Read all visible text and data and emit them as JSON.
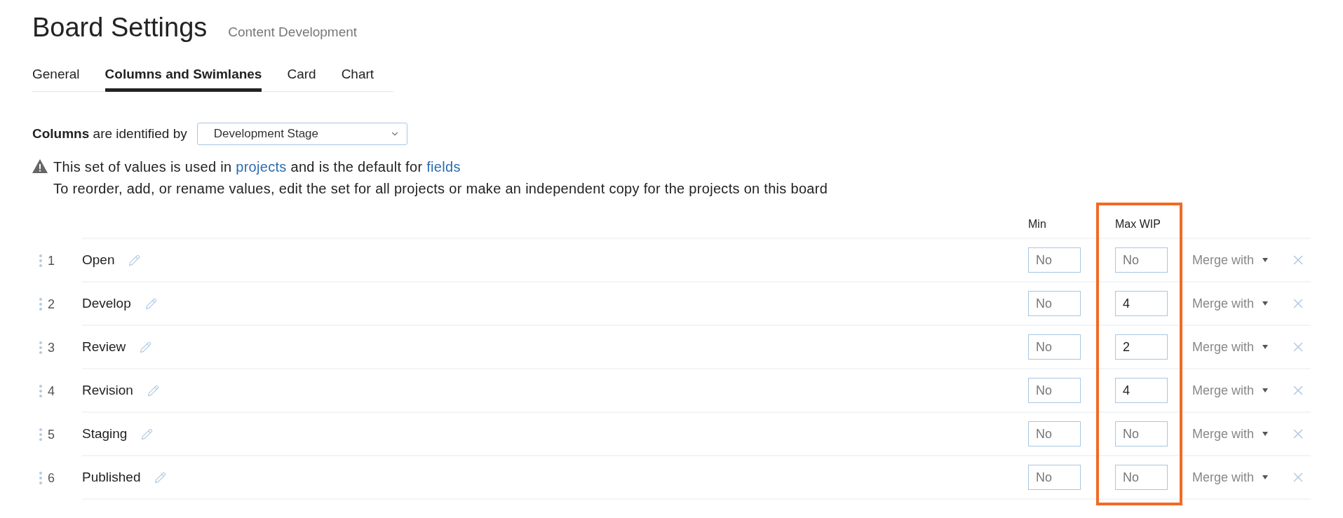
{
  "header": {
    "title": "Board Settings",
    "subtitle": "Content Development"
  },
  "tabs": [
    {
      "label": "General",
      "selected": false
    },
    {
      "label": "Columns and Swimlanes",
      "selected": true
    },
    {
      "label": "Card",
      "selected": false
    },
    {
      "label": "Chart",
      "selected": false
    }
  ],
  "identified_by": {
    "label_bold": "Columns",
    "label": "are identified by",
    "value": "Development Stage"
  },
  "notice": {
    "parts": [
      {
        "kind": "text",
        "text": "This set of values is used in "
      },
      {
        "kind": "link",
        "text": "projects"
      },
      {
        "kind": "text",
        "text": " and is the default for "
      },
      {
        "kind": "link",
        "text": "fields"
      }
    ],
    "line_2": "To reorder, add, or rename values, edit the set for all projects or make an independent copy for the projects on this board"
  },
  "table": {
    "columns": [
      {
        "label": "Min",
        "highlighted": false
      },
      {
        "label": "Max WIP",
        "highlighted": true
      }
    ],
    "rows": [
      {
        "number": "1",
        "name": "Open",
        "min": {
          "placeholder": "No"
        },
        "max_wip": {
          "placeholder": "No"
        },
        "merge": "Merge with"
      },
      {
        "number": "2",
        "name": "Develop",
        "min": {
          "placeholder": "No"
        },
        "max_wip": {
          "value": "4"
        },
        "merge": "Merge with"
      },
      {
        "number": "3",
        "name": "Review",
        "min": {
          "placeholder": "No"
        },
        "max_wip": {
          "value": "2"
        },
        "merge": "Merge with"
      },
      {
        "number": "4",
        "name": "Revision",
        "min": {
          "placeholder": "No"
        },
        "max_wip": {
          "value": "4"
        },
        "merge": "Merge with"
      },
      {
        "number": "5",
        "name": "Staging",
        "min": {
          "placeholder": "No"
        },
        "max_wip": {
          "placeholder": "No"
        },
        "merge": "Merge with"
      },
      {
        "number": "6",
        "name": "Published",
        "min": {
          "placeholder": "No"
        },
        "max_wip": {
          "placeholder": "No"
        },
        "merge": "Merge with"
      }
    ]
  }
}
